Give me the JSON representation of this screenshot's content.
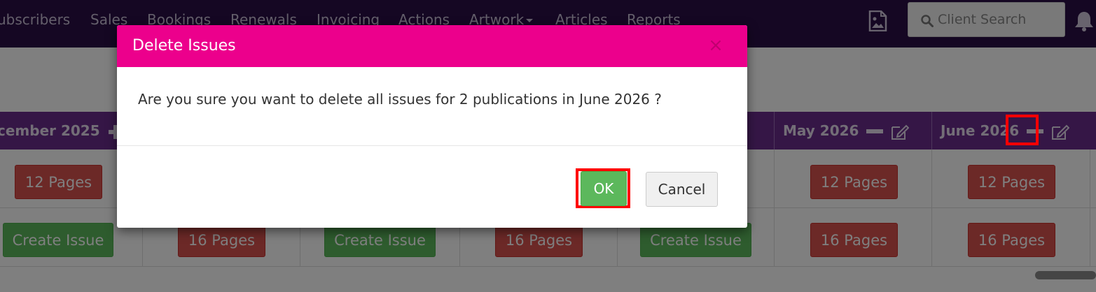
{
  "nav": {
    "items": [
      "ubscribers",
      "Sales",
      "Bookings",
      "Renewals",
      "Invoicing",
      "Actions",
      "Artwork",
      "Articles",
      "Reports"
    ],
    "search_placeholder": "Client Search",
    "icons": {
      "image": "image-icon",
      "search": "search-icon",
      "bell": "bell-icon"
    }
  },
  "grid": {
    "headers": [
      "cember 2025",
      "May 2026",
      "June 2026"
    ],
    "row1": {
      "buttons": [
        "12 Pages",
        "12 Pages",
        "12 Pages"
      ]
    },
    "row2": {
      "buttons": [
        "Create Issue",
        "16 Pages",
        "Create Issue",
        "16 Pages",
        "Create Issue",
        "16 Pages",
        "16 Pages"
      ]
    }
  },
  "modal": {
    "title": "Delete Issues",
    "close_symbol": "×",
    "message": "Are you sure you want to delete all issues for 2 publications in June 2026 ?",
    "ok_label": "OK",
    "cancel_label": "Cancel"
  },
  "colors": {
    "nav_bg": "#2b0f47",
    "header_purple": "#6a2c8c",
    "modal_header": "#ec008c",
    "danger": "#d9534f",
    "success": "#5cb85c",
    "highlight": "#ff0000"
  }
}
